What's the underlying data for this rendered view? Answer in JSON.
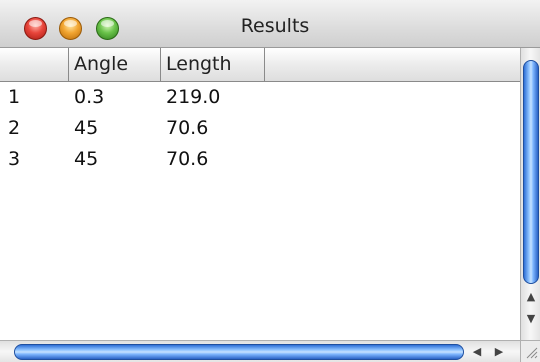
{
  "window": {
    "title": "Results"
  },
  "table": {
    "columns": [
      "",
      "Angle",
      "Length"
    ],
    "rows": [
      {
        "index": "1",
        "angle": "0.3",
        "length": "219.0"
      },
      {
        "index": "2",
        "angle": "45",
        "length": "70.6"
      },
      {
        "index": "3",
        "angle": "45",
        "length": "70.6"
      }
    ]
  },
  "scrollbars": {
    "vertical_up_icon": "arrow-up-icon",
    "vertical_down_icon": "arrow-down-icon",
    "horizontal_left_icon": "arrow-left-icon",
    "horizontal_right_icon": "arrow-right-icon"
  },
  "colors": {
    "close": "#e8453b",
    "minimize": "#f2a531",
    "zoom": "#6ac34a",
    "scroll_thumb": "#5a9cf0"
  }
}
